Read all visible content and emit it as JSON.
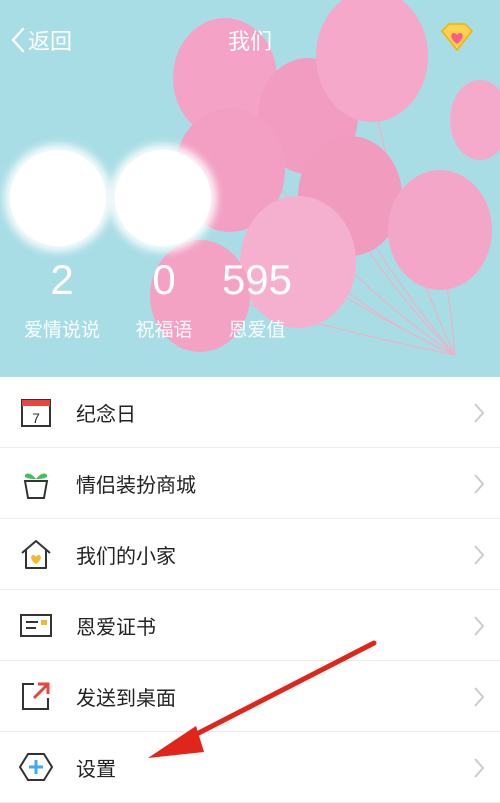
{
  "header": {
    "back_label": "返回",
    "title": "我们"
  },
  "stats": [
    {
      "value": "2",
      "label": "爱情说说"
    },
    {
      "value": "0",
      "label": "祝福语"
    },
    {
      "value": "595",
      "label": "恩爱值"
    }
  ],
  "menu": [
    {
      "label": "纪念日",
      "icon": "calendar-icon",
      "badge": "7"
    },
    {
      "label": "情侣装扮商城",
      "icon": "plant-pot-icon"
    },
    {
      "label": "我们的小家",
      "icon": "house-heart-icon"
    },
    {
      "label": "恩爱证书",
      "icon": "certificate-icon"
    },
    {
      "label": "发送到桌面",
      "icon": "send-to-desktop-icon"
    },
    {
      "label": "设置",
      "icon": "settings-plus-icon"
    }
  ],
  "colors": {
    "hero_bg": "#a9dde6",
    "balloon": "#f4a3c6",
    "arrow": "#e0251b"
  }
}
